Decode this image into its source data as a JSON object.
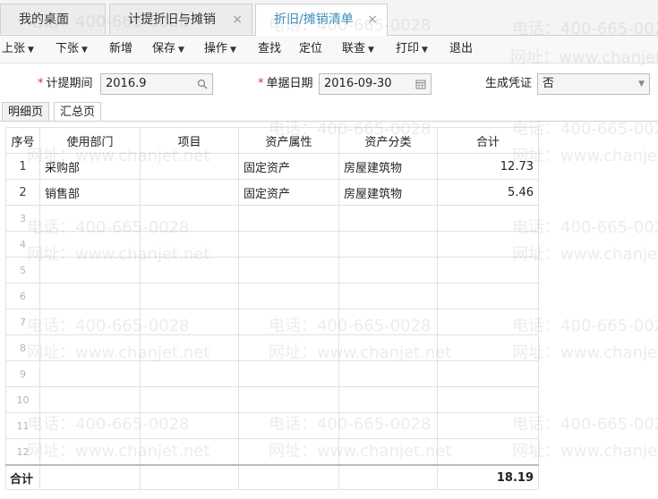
{
  "tabs": [
    {
      "label": "我的桌面",
      "closable": false,
      "active": false
    },
    {
      "label": "计提折旧与摊销",
      "closable": true,
      "active": false
    },
    {
      "label": "折旧/摊销清单",
      "closable": true,
      "active": true
    }
  ],
  "toolbar": {
    "prev": "上张",
    "next": "下张",
    "add": "新增",
    "save": "保存",
    "operate": "操作",
    "find": "查找",
    "locate": "定位",
    "linked": "联查",
    "print": "打印",
    "exit": "退出"
  },
  "form": {
    "period_label": "计提期间",
    "period_value": "2016.9",
    "date_label": "单据日期",
    "date_value": "2016-09-30",
    "voucher_label": "生成凭证",
    "voucher_value": "否"
  },
  "subtabs": [
    "明细页",
    "汇总页"
  ],
  "table": {
    "headers": [
      "序号",
      "使用部门",
      "项目",
      "资产属性",
      "资产分类",
      "合计"
    ],
    "rows": [
      {
        "no": "1",
        "dept": "采购部",
        "item": "",
        "attr": "固定资产",
        "category": "房屋建筑物",
        "total": "12.73"
      },
      {
        "no": "2",
        "dept": "销售部",
        "item": "",
        "attr": "固定资产",
        "category": "房屋建筑物",
        "total": "5.46"
      }
    ],
    "empty_rows": [
      "3",
      "4",
      "5",
      "6",
      "7",
      "8",
      "9",
      "10",
      "11",
      "12"
    ],
    "footer_label": "合计",
    "footer_total": "18.19"
  },
  "watermark": {
    "phone": "电话：400-665-0028",
    "site": "网址：www.chanjet.net"
  },
  "colors": {
    "active_tab_text": "#3a8dbf",
    "required_mark": "#d33333"
  }
}
